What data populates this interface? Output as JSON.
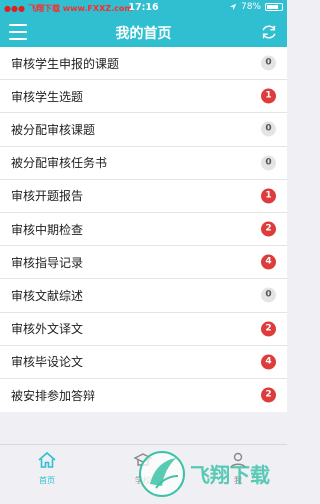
{
  "statusbar": {
    "carrier": "飞翔下载 www.FXXZ.com",
    "time": "17:16",
    "battery": "78%"
  },
  "header": {
    "title": "我的首页"
  },
  "items": [
    {
      "label": "审核学生申报的课题",
      "count": "0",
      "zero": true
    },
    {
      "label": "审核学生选题",
      "count": "1",
      "zero": false
    },
    {
      "label": "被分配审核课题",
      "count": "0",
      "zero": true
    },
    {
      "label": "被分配审核任务书",
      "count": "0",
      "zero": true
    },
    {
      "label": "审核开题报告",
      "count": "1",
      "zero": false
    },
    {
      "label": "审核中期检查",
      "count": "2",
      "zero": false
    },
    {
      "label": "审核指导记录",
      "count": "4",
      "zero": false
    },
    {
      "label": "审核文献综述",
      "count": "0",
      "zero": true
    },
    {
      "label": "审核外文译文",
      "count": "2",
      "zero": false
    },
    {
      "label": "审核毕设论文",
      "count": "4",
      "zero": false
    },
    {
      "label": "被安排参加答辩",
      "count": "2",
      "zero": false
    }
  ],
  "tabs": {
    "home": "首页",
    "school": "学校",
    "me": "我"
  },
  "watermark": {
    "text": "飞翔下载"
  },
  "colors": {
    "brand": "#2fbfd0",
    "badge": "#de3c3c",
    "badge_zero": "#e4e4e6"
  }
}
